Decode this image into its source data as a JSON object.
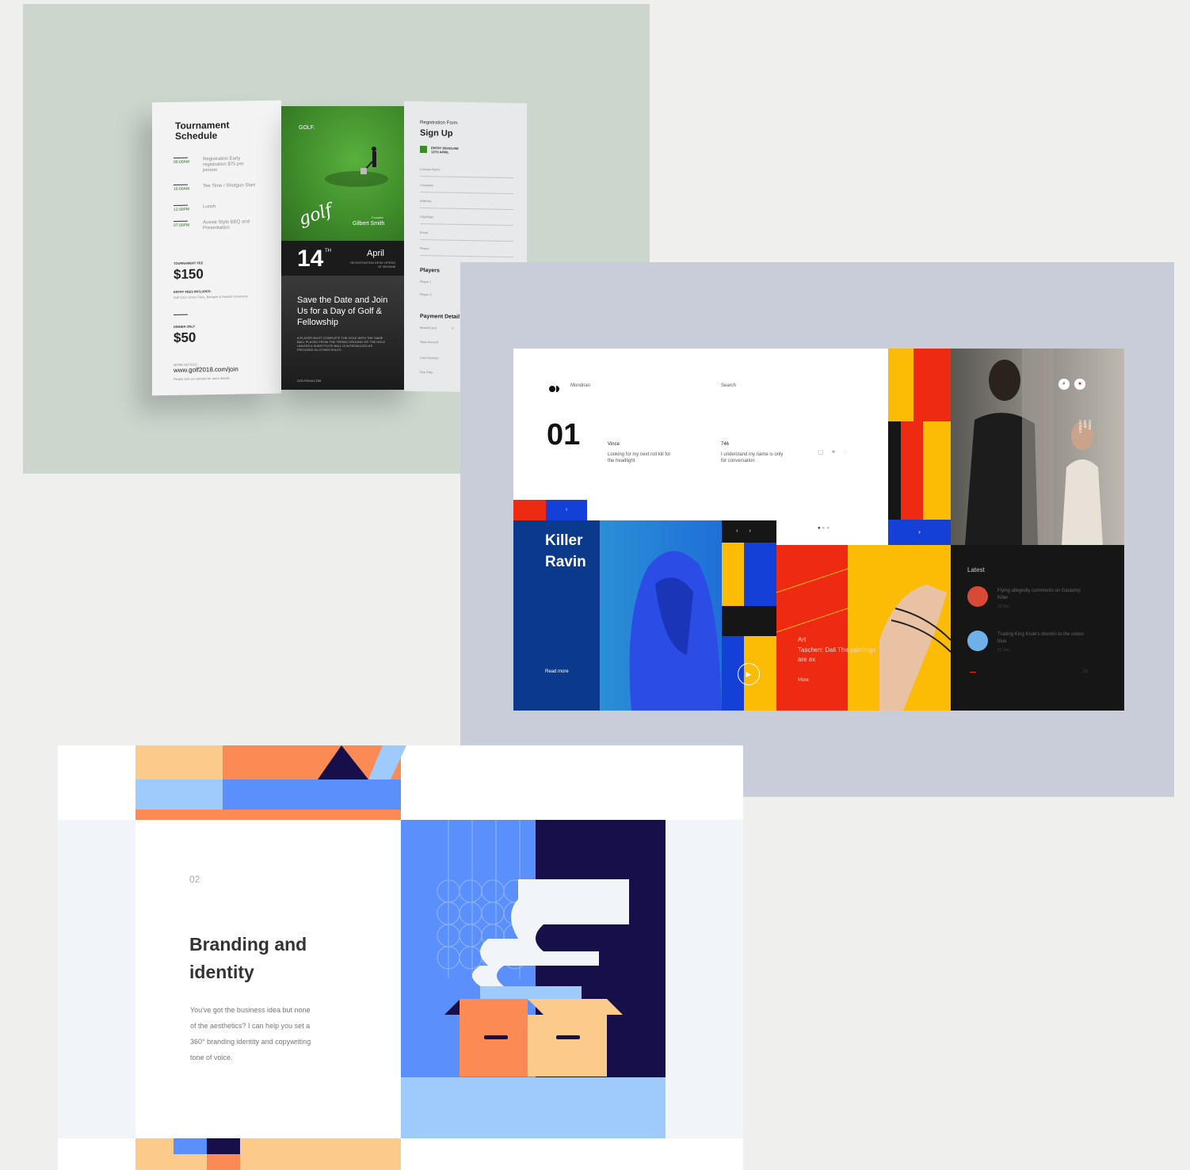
{
  "brochure": {
    "schedule_title": "Tournament Schedule",
    "schedule": [
      {
        "time": "09:00AM",
        "text": "Registration Early registration $75 per person"
      },
      {
        "time": "10:00AM",
        "text": "Tee Time / Shotgun Start"
      },
      {
        "time": "12:00PM",
        "text": "Lunch"
      },
      {
        "time": "07:00PM",
        "text": "Aussie Style BBQ and Presentation"
      }
    ],
    "fee_label": "TOURNAMENT FEE",
    "fee": "$150",
    "entry_label": "ENTRY FEES INCLUDES:",
    "entry_text": "Golf Cart, Green Fees, Banquet & Awards Ceremony",
    "dinner_label": "DINNER ONLY",
    "dinner": "$50",
    "more_label": "MORE DETAILS",
    "url": "www.golf2018.com/join",
    "url_sub": "Please visit our website for more details",
    "golf_label": "GOLF.",
    "signature": "golf",
    "founder_label": "Founder",
    "founder": "Gilbert Smith",
    "day": "14",
    "day_suffix": "TH",
    "month": "April",
    "reg_note": "REGISTRATION DESK OPENS AT 08:00AM",
    "headline": "Save the Date and Join Us for a Day of Golf & Fellowship",
    "rules_text": "A PLAYER MUST COMPLETE THE HOLE WITH THE SAME BALL PLAYED FROM THE TEEING GROUND OR THE HOLE UNLESS A SUBSTITUTE BALL IS INTRODUCED AS PROVIDED IN OTHER RULES.",
    "footer_url": "GOLF2018.COM",
    "form_kicker": "Registration Form",
    "form_title": "Sign Up",
    "deadline": "ENTRY DEADLINE 12TH APRIL",
    "fields": [
      "Contact Name",
      "Company",
      "Address",
      "City/State",
      "Email",
      "Phone"
    ],
    "players_title": "Players",
    "players": [
      "Player 1",
      "Player 2"
    ],
    "payment_title": "Payment Detail",
    "payment_options": [
      "MasterCard",
      "V"
    ],
    "payment_fields": [
      "Total Amount",
      "Card Number",
      "Exp Date"
    ]
  },
  "mondrian": {
    "brand": "Mondrian",
    "search": "Search",
    "big_number": "01",
    "col1_title": "Vince",
    "col1_text": "Looking for my next roll kill for the headlight",
    "col2_title": "746",
    "col2_text": "I understand my name is only for conversation",
    "feature_title": "Killer Ravin",
    "read_more": "Read more",
    "art_kicker": "Art",
    "art_title": "Taschen: Dali The paintings are ex",
    "more": "More",
    "side_nav": [
      "home",
      "work",
      "contact"
    ],
    "latest_title": "Latest",
    "latest": [
      {
        "title": "Flying allegedly comments on Gaslamp Killer",
        "meta": "15 Dec",
        "color": "#d84a35"
      },
      {
        "title": "Trading King Krule's devotio to the colour blue",
        "meta": "12 Dec",
        "color": "#6fb0e8"
      }
    ],
    "pager": "1/3",
    "colors": {
      "red": "#ee2b12",
      "yellow": "#fcbb05",
      "blue": "#1540d8",
      "navy": "#0b3a8c",
      "dark": "#161616"
    }
  },
  "branding": {
    "number": "02",
    "title_line1": "Branding and",
    "title_line2": "identity",
    "body": [
      "You've got the business idea but none",
      "of the aesthetics? I can help you set a",
      "360° branding identity and copywriting",
      "tone of voice."
    ],
    "colors": {
      "orange": "#fb8a55",
      "peach": "#fccb8c",
      "light_blue": "#9ecbfb",
      "blue": "#5b8ffb",
      "navy": "#170f4a",
      "pale": "#f1f4f8"
    }
  }
}
